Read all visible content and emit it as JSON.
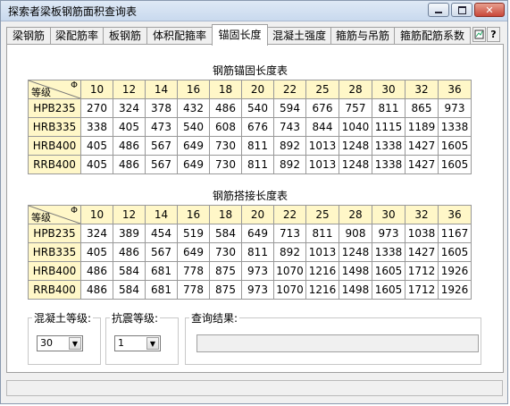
{
  "window": {
    "title": "探索者梁板钢筋面积查询表"
  },
  "tabs": [
    "梁钢筋",
    "梁配筋率",
    "板钢筋",
    "体积配箍率",
    "锚固长度",
    "混凝土强度",
    "箍筋与吊筋",
    "箍筋配筋系数"
  ],
  "active_tab": "锚固长度",
  "tab_icons": [
    "chart-icon",
    "help-icon"
  ],
  "anchor_table": {
    "title": "钢筋锚固长度表",
    "corner_label": "等级",
    "corner_symbol": "Φ",
    "diameters": [
      "10",
      "12",
      "14",
      "16",
      "18",
      "20",
      "22",
      "25",
      "28",
      "30",
      "32",
      "36"
    ],
    "rows": [
      {
        "grade": "HPB235",
        "values": [
          "270",
          "324",
          "378",
          "432",
          "486",
          "540",
          "594",
          "676",
          "757",
          "811",
          "865",
          "973"
        ]
      },
      {
        "grade": "HRB335",
        "values": [
          "338",
          "405",
          "473",
          "540",
          "608",
          "676",
          "743",
          "844",
          "1040",
          "1115",
          "1189",
          "1338"
        ]
      },
      {
        "grade": "HRB400",
        "values": [
          "405",
          "486",
          "567",
          "649",
          "730",
          "811",
          "892",
          "1013",
          "1248",
          "1338",
          "1427",
          "1605"
        ]
      },
      {
        "grade": "RRB400",
        "values": [
          "405",
          "486",
          "567",
          "649",
          "730",
          "811",
          "892",
          "1013",
          "1248",
          "1338",
          "1427",
          "1605"
        ]
      }
    ]
  },
  "lap_table": {
    "title": "钢筋搭接长度表",
    "corner_label": "等级",
    "corner_symbol": "Φ",
    "diameters": [
      "10",
      "12",
      "14",
      "16",
      "18",
      "20",
      "22",
      "25",
      "28",
      "30",
      "32",
      "36"
    ],
    "rows": [
      {
        "grade": "HPB235",
        "values": [
          "324",
          "389",
          "454",
          "519",
          "584",
          "649",
          "713",
          "811",
          "908",
          "973",
          "1038",
          "1167"
        ]
      },
      {
        "grade": "HRB335",
        "values": [
          "405",
          "486",
          "567",
          "649",
          "730",
          "811",
          "892",
          "1013",
          "1248",
          "1338",
          "1427",
          "1605"
        ]
      },
      {
        "grade": "HRB400",
        "values": [
          "486",
          "584",
          "681",
          "778",
          "875",
          "973",
          "1070",
          "1216",
          "1498",
          "1605",
          "1712",
          "1926"
        ]
      },
      {
        "grade": "RRB400",
        "values": [
          "486",
          "584",
          "681",
          "778",
          "875",
          "973",
          "1070",
          "1216",
          "1498",
          "1605",
          "1712",
          "1926"
        ]
      }
    ]
  },
  "controls": {
    "concrete_label": "混凝土等级:",
    "concrete_value": "30",
    "seismic_label": "抗震等级:",
    "seismic_value": "1",
    "result_label": "查询结果:",
    "result_value": ""
  }
}
